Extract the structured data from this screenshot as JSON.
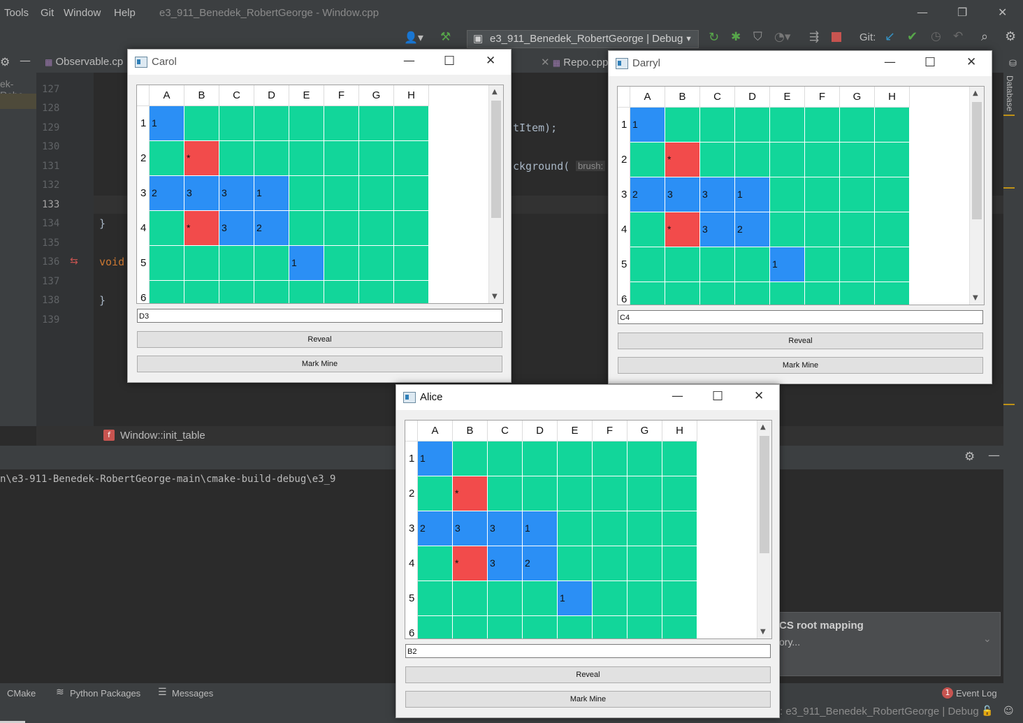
{
  "ide": {
    "menu": [
      "Tools",
      "Git",
      "Window",
      "Help"
    ],
    "window_title": "e3_911_Benedek_RobertGeorge - Window.cpp",
    "run_config": "e3_911_Benedek_RobertGeorge | Debug",
    "git_label": "Git:",
    "tabs": [
      "Observable.cp",
      "Repo.cpp"
    ],
    "project_label": "ek-Robe",
    "line_numbers": [
      "127",
      "128",
      "129",
      "130",
      "131",
      "132",
      "133",
      "134",
      "135",
      "136",
      "137",
      "138",
      "139"
    ],
    "code": {
      "line129": "tItem);",
      "line131": "ckground(",
      "line131_hint": "brush:",
      "line134": "}",
      "line136": "void",
      "line138": "}"
    },
    "breadcrumb": "Window::init_table",
    "run_path": "n\\e3-911-Benedek-RobertGeorge-main\\cmake-build-debug\\e3_9",
    "notification": {
      "title": "CS root mapping",
      "body": "ory..."
    },
    "tool_windows": [
      "CMake",
      "Python Packages",
      "Messages"
    ],
    "event_log": "Event Log",
    "event_count": "1",
    "status_right": ": e3_911_Benedek_RobertGeorge | Debug",
    "database_label": "Database"
  },
  "game": {
    "columns": [
      "A",
      "B",
      "C",
      "D",
      "E",
      "F",
      "G",
      "H"
    ],
    "rows": [
      "1",
      "2",
      "3",
      "4",
      "5",
      "6"
    ],
    "colors": {
      "hidden": "#12d69a",
      "revealed": "#2b8ff5",
      "mine": "#f24b4b"
    },
    "grid": [
      [
        {
          "c": "blue",
          "t": "1"
        },
        {
          "c": "green",
          "t": ""
        },
        {
          "c": "green",
          "t": ""
        },
        {
          "c": "green",
          "t": ""
        },
        {
          "c": "green",
          "t": ""
        },
        {
          "c": "green",
          "t": ""
        },
        {
          "c": "green",
          "t": ""
        },
        {
          "c": "green",
          "t": ""
        }
      ],
      [
        {
          "c": "green",
          "t": ""
        },
        {
          "c": "red",
          "t": "*"
        },
        {
          "c": "green",
          "t": ""
        },
        {
          "c": "green",
          "t": ""
        },
        {
          "c": "green",
          "t": ""
        },
        {
          "c": "green",
          "t": ""
        },
        {
          "c": "green",
          "t": ""
        },
        {
          "c": "green",
          "t": ""
        }
      ],
      [
        {
          "c": "blue",
          "t": "2"
        },
        {
          "c": "blue",
          "t": "3"
        },
        {
          "c": "blue",
          "t": "3"
        },
        {
          "c": "blue",
          "t": "1"
        },
        {
          "c": "green",
          "t": ""
        },
        {
          "c": "green",
          "t": ""
        },
        {
          "c": "green",
          "t": ""
        },
        {
          "c": "green",
          "t": ""
        }
      ],
      [
        {
          "c": "green",
          "t": ""
        },
        {
          "c": "red",
          "t": "*"
        },
        {
          "c": "blue",
          "t": "3"
        },
        {
          "c": "blue",
          "t": "2"
        },
        {
          "c": "green",
          "t": ""
        },
        {
          "c": "green",
          "t": ""
        },
        {
          "c": "green",
          "t": ""
        },
        {
          "c": "green",
          "t": ""
        }
      ],
      [
        {
          "c": "green",
          "t": ""
        },
        {
          "c": "green",
          "t": ""
        },
        {
          "c": "green",
          "t": ""
        },
        {
          "c": "green",
          "t": ""
        },
        {
          "c": "blue",
          "t": "1"
        },
        {
          "c": "green",
          "t": ""
        },
        {
          "c": "green",
          "t": ""
        },
        {
          "c": "green",
          "t": ""
        }
      ],
      [
        {
          "c": "green",
          "t": ""
        },
        {
          "c": "green",
          "t": ""
        },
        {
          "c": "green",
          "t": ""
        },
        {
          "c": "green",
          "t": ""
        },
        {
          "c": "green",
          "t": ""
        },
        {
          "c": "green",
          "t": ""
        },
        {
          "c": "green",
          "t": ""
        },
        {
          "c": "green",
          "t": ""
        }
      ]
    ],
    "reveal_label": "Reveal",
    "mark_label": "Mark Mine"
  },
  "windows": {
    "carol": {
      "title": "Carol",
      "input": "D3"
    },
    "darryl": {
      "title": "Darryl",
      "input": "C4"
    },
    "alice": {
      "title": "Alice",
      "input": "B2"
    }
  }
}
